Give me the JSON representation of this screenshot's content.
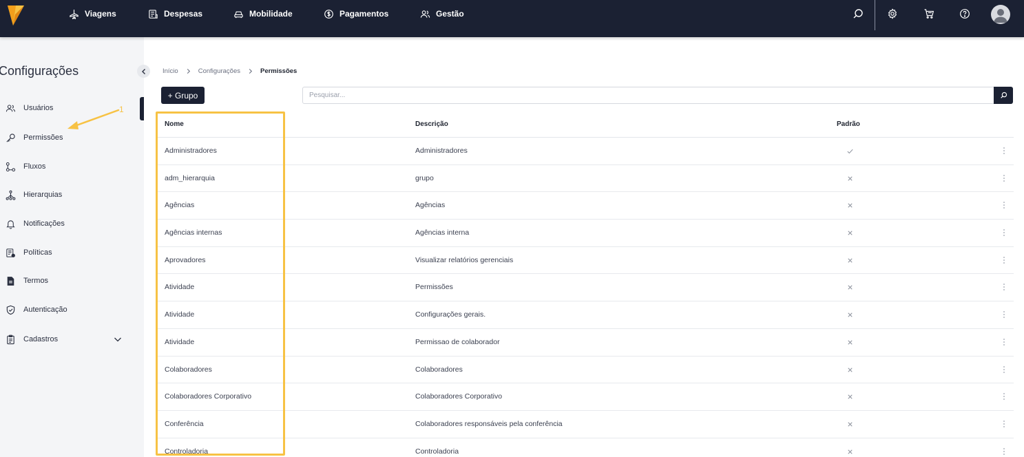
{
  "topbar": {
    "nav": [
      {
        "label": "Viagens",
        "icon": "plane-icon"
      },
      {
        "label": "Despesas",
        "icon": "receipt-icon"
      },
      {
        "label": "Mobilidade",
        "icon": "car-icon"
      },
      {
        "label": "Pagamentos",
        "icon": "dollar-circle-icon"
      },
      {
        "label": "Gestão",
        "icon": "users-icon"
      }
    ],
    "icons": [
      "search-icon",
      "gear-icon",
      "cart-icon",
      "help-icon",
      "avatar-icon"
    ]
  },
  "sidebar": {
    "title": "Configurações",
    "items": [
      {
        "label": "Usuários",
        "icon": "users-icon"
      },
      {
        "label": "Permissões",
        "icon": "key-icon"
      },
      {
        "label": "Fluxos",
        "icon": "flow-icon"
      },
      {
        "label": "Hierarquias",
        "icon": "hierarchy-icon"
      },
      {
        "label": "Notificações",
        "icon": "bell-icon"
      },
      {
        "label": "Políticas",
        "icon": "policy-icon"
      },
      {
        "label": "Termos",
        "icon": "document-icon"
      },
      {
        "label": "Autenticação",
        "icon": "shield-icon"
      },
      {
        "label": "Cadastros",
        "icon": "clipboard-icon"
      }
    ]
  },
  "breadcrumb": {
    "items": [
      "Início",
      "Configurações",
      "Permissões"
    ]
  },
  "toolbar": {
    "add_label": "+ Grupo",
    "search_placeholder": "Pesquisar..."
  },
  "table": {
    "headers": {
      "name": "Nome",
      "description": "Descrição",
      "default": "Padrão"
    },
    "rows": [
      {
        "name": "Administradores",
        "description": "Administradores",
        "default": true
      },
      {
        "name": "adm_hierarquia",
        "description": "grupo",
        "default": false
      },
      {
        "name": "Agências",
        "description": "Agências",
        "default": false
      },
      {
        "name": "Agências internas",
        "description": "Agências interna",
        "default": false
      },
      {
        "name": "Aprovadores",
        "description": "Visualizar relatórios gerenciais",
        "default": false
      },
      {
        "name": "Atividade",
        "description": "Permissões",
        "default": false
      },
      {
        "name": "Atividade",
        "description": "Configurações gerais.",
        "default": false
      },
      {
        "name": "Atividade",
        "description": "Permissao de colaborador",
        "default": false
      },
      {
        "name": "Colaboradores",
        "description": "Colaboradores",
        "default": false
      },
      {
        "name": "Colaboradores Corporativo",
        "description": "Colaboradores Corporativo",
        "default": false
      },
      {
        "name": "Conferência",
        "description": "Colaboradores responsáveis pela conferência",
        "default": false
      },
      {
        "name": "Controladoria",
        "description": "Controladoria",
        "default": false
      }
    ]
  },
  "annotation": {
    "number": "1"
  },
  "colors": {
    "navy": "#1b2133",
    "accent": "#f7c244",
    "sidebar_bg": "#f4f5f7"
  }
}
